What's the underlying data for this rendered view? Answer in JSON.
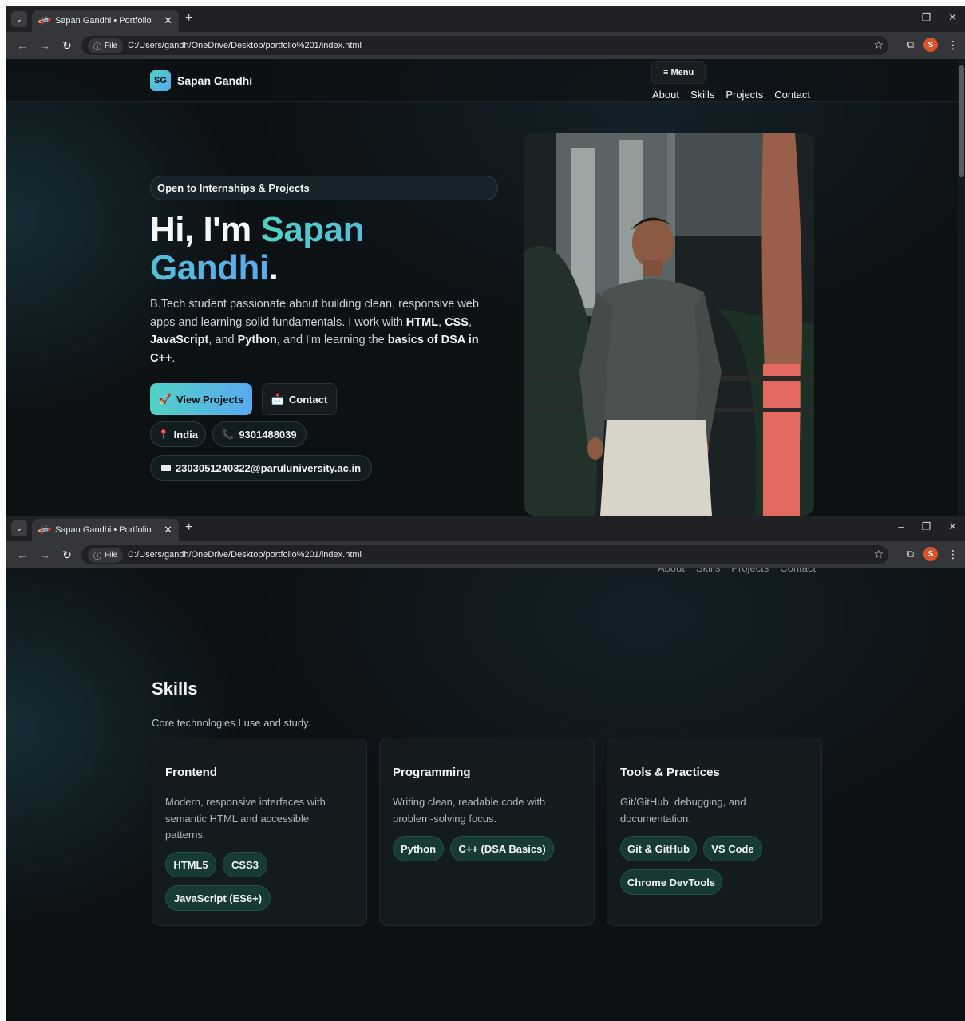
{
  "browser": {
    "tab_title": "Sapan Gandhi • Portfolio",
    "info_chip": "File",
    "url": "C:/Users/gandh/OneDrive/Desktop/portfolio%201/index.html",
    "profile_initial": "S"
  },
  "header": {
    "logo": "SG",
    "brand_name": "Sapan Gandhi",
    "menu_label": "≡ Menu",
    "nav": [
      "About",
      "Skills",
      "Projects",
      "Contact"
    ]
  },
  "hero": {
    "badge": "Open to Internships & Projects",
    "title_prefix": "Hi, I'm ",
    "title_name": "Sapan Gandhi",
    "title_suffix": ".",
    "description": {
      "t1": "B.Tech student passionate about building clean, responsive web apps and learning solid fundamentals. I work with ",
      "html": "HTML",
      "sep1": ", ",
      "css": "CSS",
      "sep2": ", ",
      "js": "JavaScript",
      "sep3": ", and ",
      "python": "Python",
      "t2": ", and I'm learning the ",
      "dsa": "basics of DSA in C++",
      "t3": "."
    },
    "primary_button": "View Projects",
    "primary_icon": "🚀",
    "secondary_button": "Contact",
    "secondary_icon": "📩",
    "location": "India",
    "phone": "9301488039",
    "email": "2303051240322@paruluniversity.ac.in"
  },
  "skills": {
    "title": "Skills",
    "subtitle": "Core technologies I use and study.",
    "cards": [
      {
        "title": "Frontend",
        "description": "Modern, responsive interfaces with semantic HTML and accessible patterns.",
        "tags": [
          "HTML5",
          "CSS3",
          "JavaScript (ES6+)"
        ]
      },
      {
        "title": "Programming",
        "description": "Writing clean, readable code with problem-solving focus.",
        "tags": [
          "Python",
          "C++ (DSA Basics)"
        ]
      },
      {
        "title": "Tools & Practices",
        "description": "Git/GitHub, debugging, and documentation.",
        "tags": [
          "Git & GitHub",
          "VS Code",
          "Chrome DevTools"
        ]
      }
    ]
  }
}
